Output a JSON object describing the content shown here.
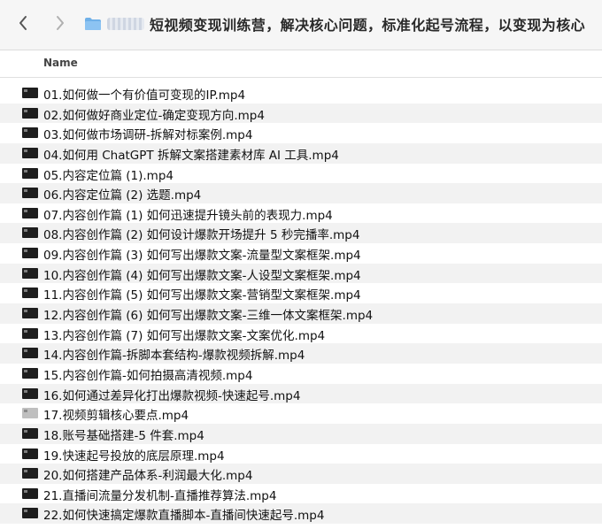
{
  "toolbar": {
    "folder_title": "短视频变现训练营，解决核心问题，标准化起号流程，以变现为核心"
  },
  "columns": {
    "name": "Name"
  },
  "files": [
    {
      "name": "01.如何做一个有价值可变现的IP.mp4",
      "icon": "video-file-icon"
    },
    {
      "name": "02.如何做好商业定位-确定变现方向.mp4",
      "icon": "video-file-icon"
    },
    {
      "name": "03.如何做市场调研-拆解对标案例.mp4",
      "icon": "video-file-icon"
    },
    {
      "name": "04.如何用 ChatGPT 拆解文案搭建素材库 AI 工具.mp4",
      "icon": "video-file-icon"
    },
    {
      "name": "05.内容定位篇 (1).mp4",
      "icon": "video-file-icon"
    },
    {
      "name": "06.内容定位篇 (2) 选题.mp4",
      "icon": "video-file-icon"
    },
    {
      "name": "07.内容创作篇 (1) 如何迅速提升镜头前的表现力.mp4",
      "icon": "video-file-icon"
    },
    {
      "name": "08.内容创作篇 (2) 如何设计爆款开场提升 5 秒完播率.mp4",
      "icon": "video-file-icon"
    },
    {
      "name": "09.内容创作篇 (3) 如何写出爆款文案-流量型文案框架.mp4",
      "icon": "video-file-icon"
    },
    {
      "name": "10.内容创作篇 (4) 如何写出爆款文案-人设型文案框架.mp4",
      "icon": "video-file-icon"
    },
    {
      "name": "11.内容创作篇 (5) 如何写出爆款文案-营销型文案框架.mp4",
      "icon": "video-file-icon"
    },
    {
      "name": "12.内容创作篇 (6) 如何写出爆款文案-三维一体文案框架.mp4",
      "icon": "video-file-icon"
    },
    {
      "name": "13.内容创作篇 (7) 如何写出爆款文案-文案优化.mp4",
      "icon": "video-file-icon"
    },
    {
      "name": "14.内容创作篇-拆脚本套结构-爆款视频拆解.mp4",
      "icon": "video-file-icon"
    },
    {
      "name": "15.内容创作篇-如何拍摄高清视频.mp4",
      "icon": "video-file-icon"
    },
    {
      "name": "16.如何通过差异化打出爆款视频-快速起号.mp4",
      "icon": "video-file-icon"
    },
    {
      "name": "17.视频剪辑核心要点.mp4",
      "icon": "video-file-icon-light"
    },
    {
      "name": "18.账号基础搭建-5 件套.mp4",
      "icon": "video-file-icon"
    },
    {
      "name": "19.快速起号投放的底层原理.mp4",
      "icon": "video-file-icon"
    },
    {
      "name": "20.如何搭建产品体系-利润最大化.mp4",
      "icon": "video-file-icon"
    },
    {
      "name": "21.直播间流量分发机制-直播推荐算法.mp4",
      "icon": "video-file-icon"
    },
    {
      "name": "22.如何快速搞定爆款直播脚本-直播间快速起号.mp4",
      "icon": "video-file-icon"
    }
  ]
}
